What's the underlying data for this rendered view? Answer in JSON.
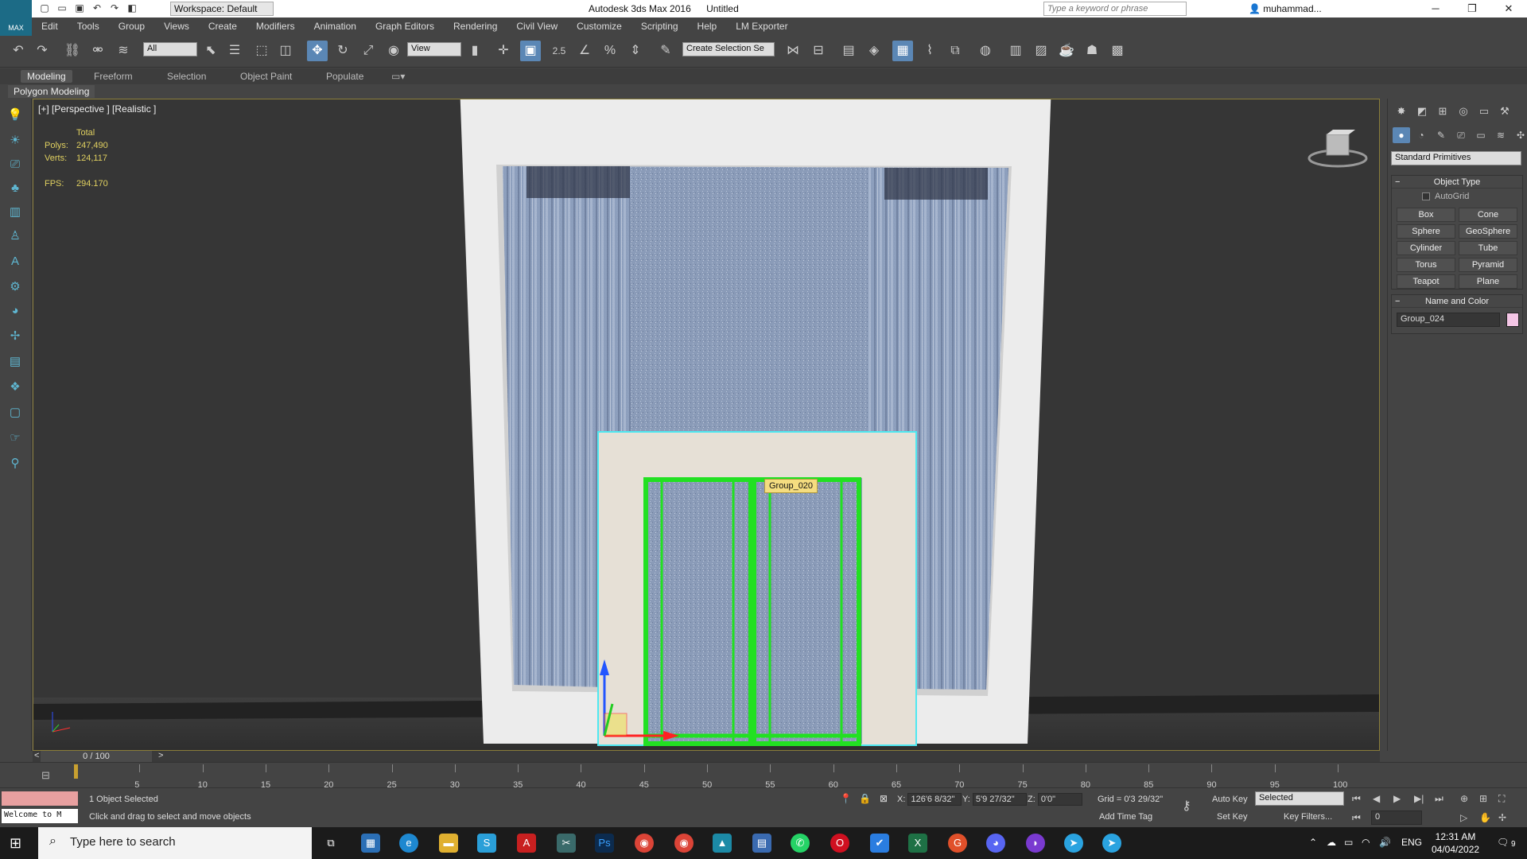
{
  "titlebar": {
    "logo": "MAX",
    "workspace": "Workspace: Default",
    "app_name": "Autodesk 3ds Max 2016",
    "doc_name": "Untitled",
    "search_placeholder": "Type a keyword or phrase",
    "user": "muhammad..."
  },
  "menu": [
    "Edit",
    "Tools",
    "Group",
    "Views",
    "Create",
    "Modifiers",
    "Animation",
    "Graph Editors",
    "Rendering",
    "Civil View",
    "Customize",
    "Scripting",
    "Help",
    "LM Exporter"
  ],
  "toolbar": {
    "selection_filter": "All",
    "ref_coord": "View",
    "named_selection": "Create Selection Se",
    "snap_label": "2.5"
  },
  "ribbon": {
    "tabs": [
      "Modeling",
      "Freeform",
      "Selection",
      "Object Paint",
      "Populate"
    ],
    "active_tab": "Modeling",
    "sub_label": "Polygon Modeling"
  },
  "viewport": {
    "label": "[+] [Perspective ] [Realistic ]",
    "stats": {
      "header": "Total",
      "polys_label": "Polys:",
      "polys": "247,490",
      "verts_label": "Verts:",
      "verts": "124,117",
      "fps_label": "FPS:",
      "fps": "294.170"
    },
    "selected_group_tag": "Group_020"
  },
  "command_panel": {
    "category": "Standard Primitives",
    "object_type_title": "Object Type",
    "autogrid": "AutoGrid",
    "primitives": [
      "Box",
      "Cone",
      "Sphere",
      "GeoSphere",
      "Cylinder",
      "Tube",
      "Torus",
      "Pyramid",
      "Teapot",
      "Plane"
    ],
    "name_color_title": "Name and Color",
    "object_name": "Group_024",
    "object_color": "#f4c6e6"
  },
  "timeline": {
    "frame_display": "0 / 100",
    "ticks": [
      "5",
      "10",
      "15",
      "20",
      "25",
      "30",
      "35",
      "40",
      "45",
      "50",
      "55",
      "60",
      "65",
      "70",
      "75",
      "80",
      "85",
      "90",
      "95",
      "100"
    ]
  },
  "status": {
    "maxscript_welcome": "Welcome to M",
    "selection": "1 Object Selected",
    "prompt": "Click and drag to select and move objects",
    "x_label": "X:",
    "x": "126'6 8/32\"",
    "y_label": "Y:",
    "y": "5'9 27/32\"",
    "z_label": "Z:",
    "z": "0'0\"",
    "grid": "Grid = 0'3 29/32\"",
    "add_time_tag": "Add Time Tag",
    "auto_key": "Auto Key",
    "set_key": "Set Key",
    "key_mode": "Selected",
    "key_filters": "Key Filters...",
    "current_frame": "0"
  },
  "taskbar": {
    "search_placeholder": "Type here to search",
    "language": "ENG",
    "time": "12:31 AM",
    "date": "04/04/2022",
    "notifications": "9"
  },
  "colors": {
    "accent": "#5b87b5",
    "selection_green": "#22e022",
    "viewport_border": "#8a7d3a",
    "stats_text": "#e0d060"
  }
}
